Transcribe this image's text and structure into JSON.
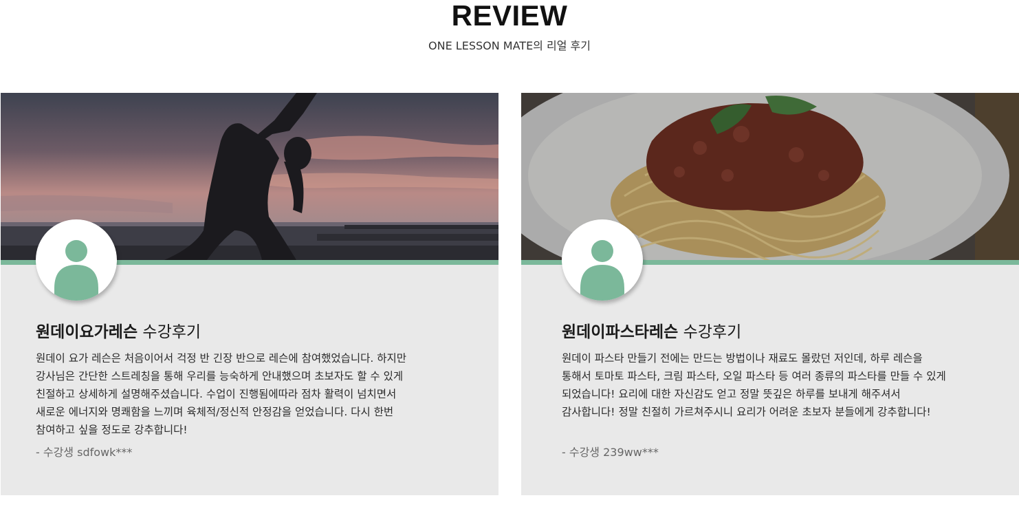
{
  "header": {
    "title": "REVIEW",
    "subtitle": "ONE LESSON MATE의 리얼 후기"
  },
  "colors": {
    "accent": "#7bb89a",
    "card_bg": "#e9e9e9"
  },
  "reviews": [
    {
      "image": "yoga-sunset-photo",
      "avatar_icon": "user-avatar-icon",
      "title_bold": "원데이요가레슨",
      "title_suffix": " 수강후기",
      "body_lines": [
        "원데이 요가 레슨은 처음이어서 걱정 반 긴장 반으로 레슨에 참여했었습니다. 하지만",
        "강사님은 간단한 스트레칭을 통해 우리를 능숙하게 안내했으며 초보자도 할 수 있게",
        "친절하고 상세하게 설명해주셨습니다. 수업이 진행됨에따라 점차 활력이 넘치면서",
        "새로운 에너지와 명쾌함을 느끼며 육체적/정신적 안정감을 얻었습니다. 다시 한번",
        "참여하고 싶을 정도로 강추합니다!"
      ],
      "author": "- 수강생 sdfowk***"
    },
    {
      "image": "pasta-bolognese-photo",
      "avatar_icon": "user-avatar-icon",
      "title_bold": "원데이파스타레슨",
      "title_suffix": " 수강후기",
      "body_lines": [
        "원데이 파스타 만들기 전에는 만드는 방법이나 재료도 몰랐던 저인데, 하루 레슨을",
        "통해서 토마토 파스타, 크림 파스타, 오일 파스타 등 여러 종류의 파스타를 만들 수 있게",
        "되었습니다! 요리에 대한 자신감도 얻고 정말 뜻깊은 하루를 보내게 해주셔서",
        "감사합니다! 정말 친절히 가르쳐주시니 요리가 어려운 초보자 분들에게 강추합니다!"
      ],
      "author": "- 수강생 239ww***"
    }
  ]
}
